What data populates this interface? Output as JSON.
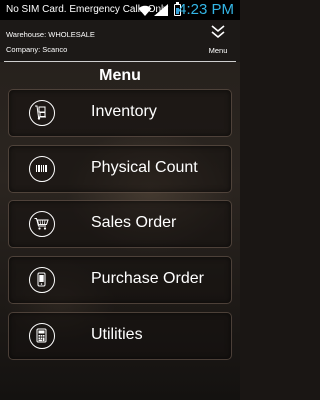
{
  "status_bar": {
    "carrier": "No SIM Card. Emergency Calls Only",
    "time": "4:23 PM",
    "icons": [
      "wifi-icon",
      "signal-icon",
      "battery-icon"
    ],
    "battery_level": 0.7,
    "time_color": "#33b5e5"
  },
  "header": {
    "warehouse": "Warehouse: WHOLESALE",
    "company": "Company: Scanco",
    "menu_label": "Menu"
  },
  "page_title": "Menu",
  "menu_items": [
    {
      "label": "Inventory",
      "icon": "hand-truck-icon"
    },
    {
      "label": "Physical Count",
      "icon": "barcode-icon"
    },
    {
      "label": "Sales Order",
      "icon": "shopping-cart-icon"
    },
    {
      "label": "Purchase Order",
      "icon": "mobile-device-icon"
    },
    {
      "label": "Utilities",
      "icon": "calculator-icon"
    }
  ]
}
